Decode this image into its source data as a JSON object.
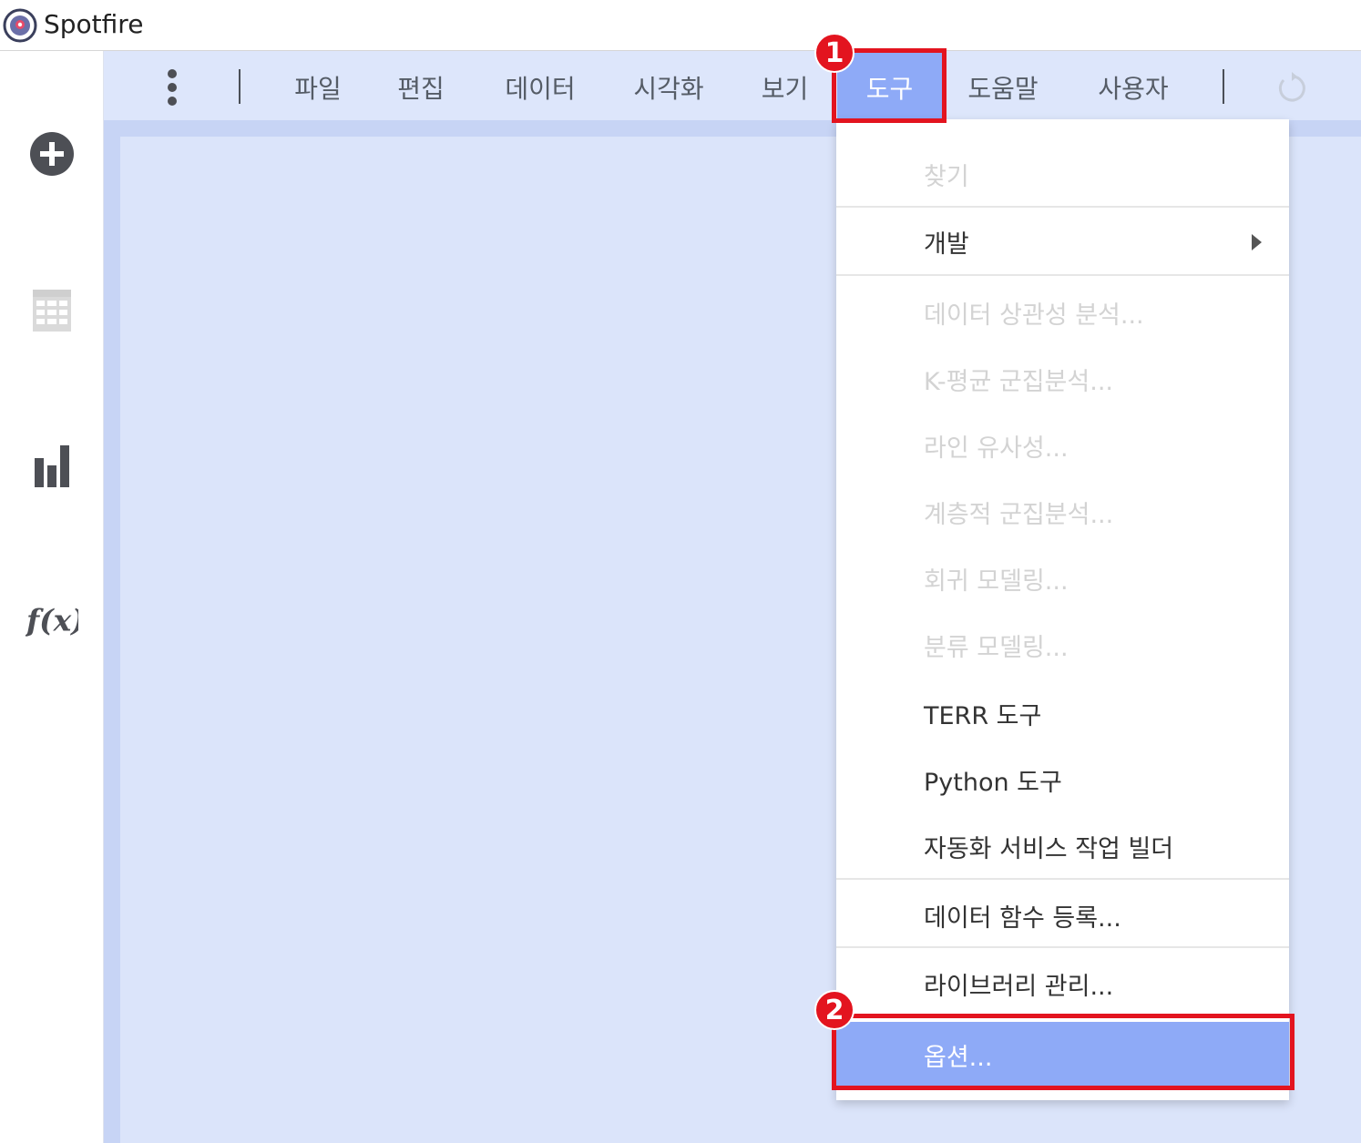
{
  "app": {
    "title": "Spotfire"
  },
  "toolbar": {
    "menus": [
      "파일",
      "편집",
      "데이터",
      "시각화",
      "보기",
      "도구",
      "도움말",
      "사용자"
    ],
    "active_menu": "도구"
  },
  "tools_menu": {
    "items": [
      {
        "label": "찾기",
        "enabled": false
      },
      {
        "label": "개발",
        "enabled": true,
        "has_submenu": true
      },
      {
        "label": "데이터 상관성 분석...",
        "enabled": false
      },
      {
        "label": "K-평균 군집분석...",
        "enabled": false
      },
      {
        "label": "라인 유사성...",
        "enabled": false
      },
      {
        "label": "계층적 군집분석...",
        "enabled": false
      },
      {
        "label": "회귀 모델링...",
        "enabled": false
      },
      {
        "label": "분류 모델링...",
        "enabled": false
      },
      {
        "label": "TERR 도구",
        "enabled": true
      },
      {
        "label": "Python 도구",
        "enabled": true
      },
      {
        "label": "자동화 서비스 작업 빌더",
        "enabled": true
      },
      {
        "label": "데이터 함수 등록...",
        "enabled": true
      },
      {
        "label": "라이브러리 관리...",
        "enabled": true
      },
      {
        "label": "옵션...",
        "enabled": true,
        "selected": true
      }
    ]
  },
  "annotations": {
    "step1": "1",
    "step2": "2"
  },
  "colors": {
    "highlight": "#e3141f",
    "accent": "#8eaaf7",
    "canvas": "#dbe4fa"
  }
}
